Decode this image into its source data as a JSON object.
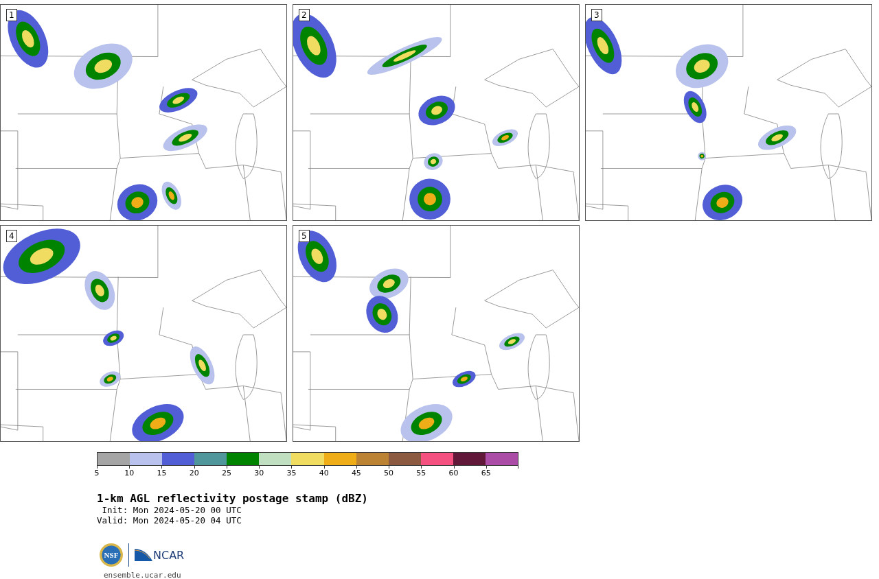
{
  "panels": [
    {
      "number": "1"
    },
    {
      "number": "2"
    },
    {
      "number": "3"
    },
    {
      "number": "4"
    },
    {
      "number": "5"
    }
  ],
  "colorbar": {
    "segments": [
      {
        "color": "#a5a5a5"
      },
      {
        "color": "#b8c2ec"
      },
      {
        "color": "#525ed6"
      },
      {
        "color": "#50979c"
      },
      {
        "color": "#008400"
      },
      {
        "color": "#c0dec0"
      },
      {
        "color": "#f0dc60"
      },
      {
        "color": "#efae17"
      },
      {
        "color": "#bb8333"
      },
      {
        "color": "#8c5a40"
      },
      {
        "color": "#f55180"
      },
      {
        "color": "#621838"
      },
      {
        "color": "#ab4ca6"
      }
    ],
    "ticks": [
      "5",
      "10",
      "15",
      "20",
      "25",
      "30",
      "35",
      "40",
      "45",
      "50",
      "55",
      "60",
      "65"
    ]
  },
  "title": "1-km AGL reflectivity postage stamp (dBZ)",
  "init": " Init: Mon 2024-05-20 00 UTC",
  "valid": "Valid: Mon 2024-05-20 04 UTC",
  "logos": {
    "nsf": "NSF",
    "ncar": "NCAR"
  },
  "url": "ensemble.ucar.edu"
}
